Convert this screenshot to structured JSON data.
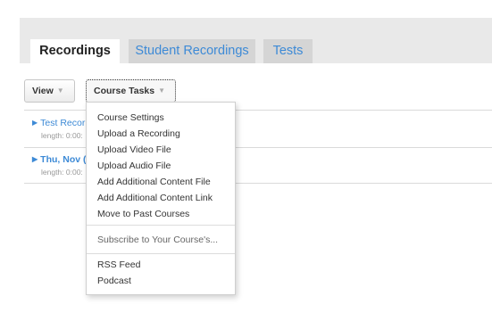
{
  "tabs": [
    {
      "label": "Recordings"
    },
    {
      "label": "Student Recordings"
    },
    {
      "label": "Tests"
    }
  ],
  "toolbar": {
    "view_label": "View",
    "course_tasks_label": "Course Tasks",
    "caret": "▼"
  },
  "recordings": [
    {
      "title": "Test Recor",
      "length": "length: 0:00:"
    },
    {
      "title": "Thu, Nov (",
      "length": "length: 0:00:"
    }
  ],
  "menu": {
    "group1": [
      "Course Settings",
      "Upload a Recording",
      "Upload Video File",
      "Upload Audio File",
      "Add Additional Content File",
      "Add Additional Content Link",
      "Move to Past Courses"
    ],
    "subscribe": "Subscribe to Your Course's...",
    "group2": [
      "RSS Feed",
      "Podcast"
    ]
  },
  "colors": {
    "link": "#3d8ad6",
    "header_bg": "#e9e9e9",
    "inactive_tab_bg": "#d5d5d5"
  }
}
